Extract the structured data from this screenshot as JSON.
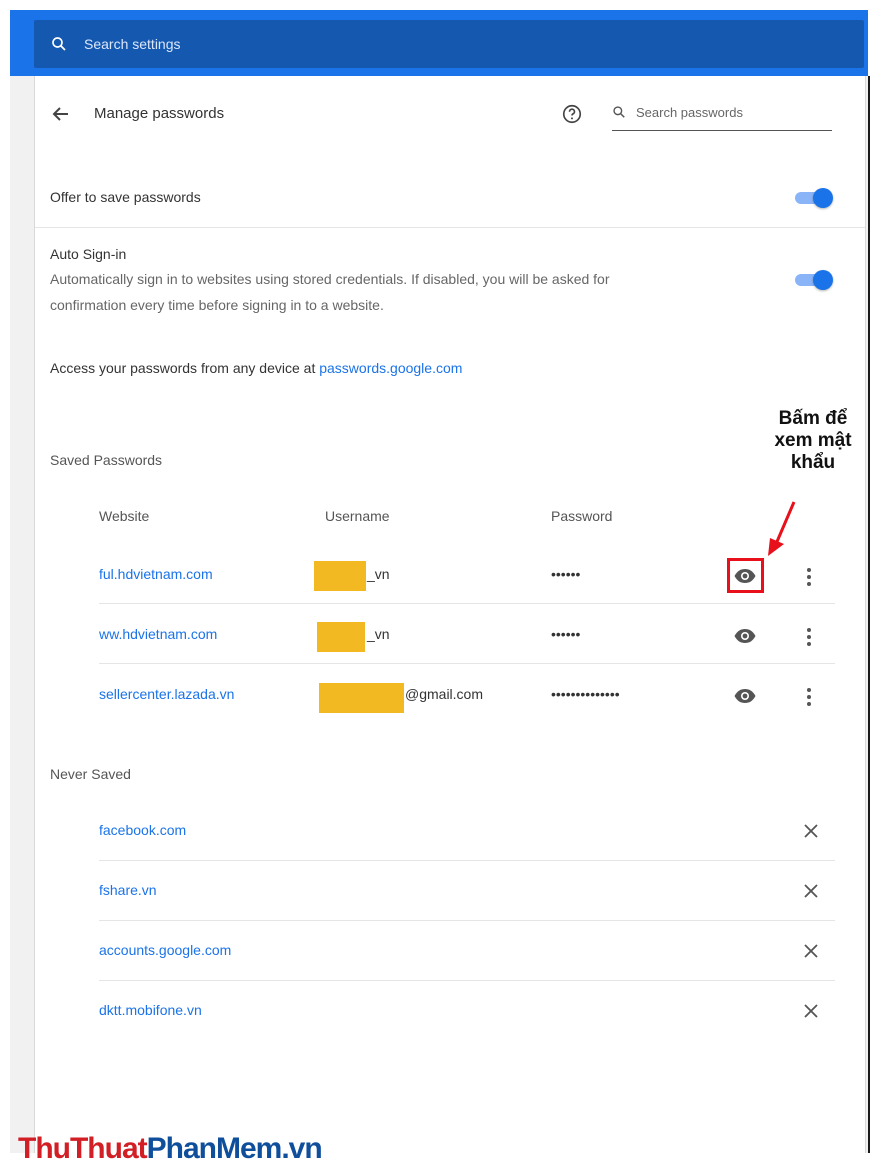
{
  "search_settings": {
    "placeholder": "Search settings",
    "icon": "search-icon"
  },
  "header": {
    "title": "Manage passwords",
    "help_icon": "help-icon",
    "search_placeholder": "Search passwords"
  },
  "offer_to_save": {
    "label": "Offer to save passwords",
    "enabled": true
  },
  "auto_signin": {
    "label": "Auto Sign-in",
    "description_line1": "Automatically sign in to websites using stored credentials. If disabled, you will be asked for",
    "description_line2": "confirmation every time before signing in to a website.",
    "enabled": true
  },
  "access": {
    "text": "Access your passwords from any device at ",
    "link": "passwords.google.com"
  },
  "saved_passwords": {
    "title": "Saved Passwords",
    "columns": {
      "website": "Website",
      "username": "Username",
      "password": "Password"
    },
    "rows": [
      {
        "website": "ful.hdvietnam.com",
        "username_visible": "_vn",
        "password": "••••••"
      },
      {
        "website": "ww.hdvietnam.com",
        "username_visible": "_vn",
        "password": "••••••"
      },
      {
        "website": "sellercenter.lazada.vn",
        "username_visible": "@gmail.com",
        "password": "••••••••••••••"
      }
    ]
  },
  "never_saved": {
    "title": "Never Saved",
    "sites": [
      "facebook.com",
      "fshare.vn",
      "accounts.google.com",
      "dktt.mobifone.vn"
    ]
  },
  "annotation": {
    "line1": "Bấm để",
    "line2": "xem mật",
    "line3": "khẩu",
    "color": "#e8101b"
  },
  "watermark": {
    "part1": "ThuThuat",
    "part2": "PhanMem.vn"
  },
  "colors": {
    "accent": "#1a73e8",
    "redact": "#f2b922"
  }
}
